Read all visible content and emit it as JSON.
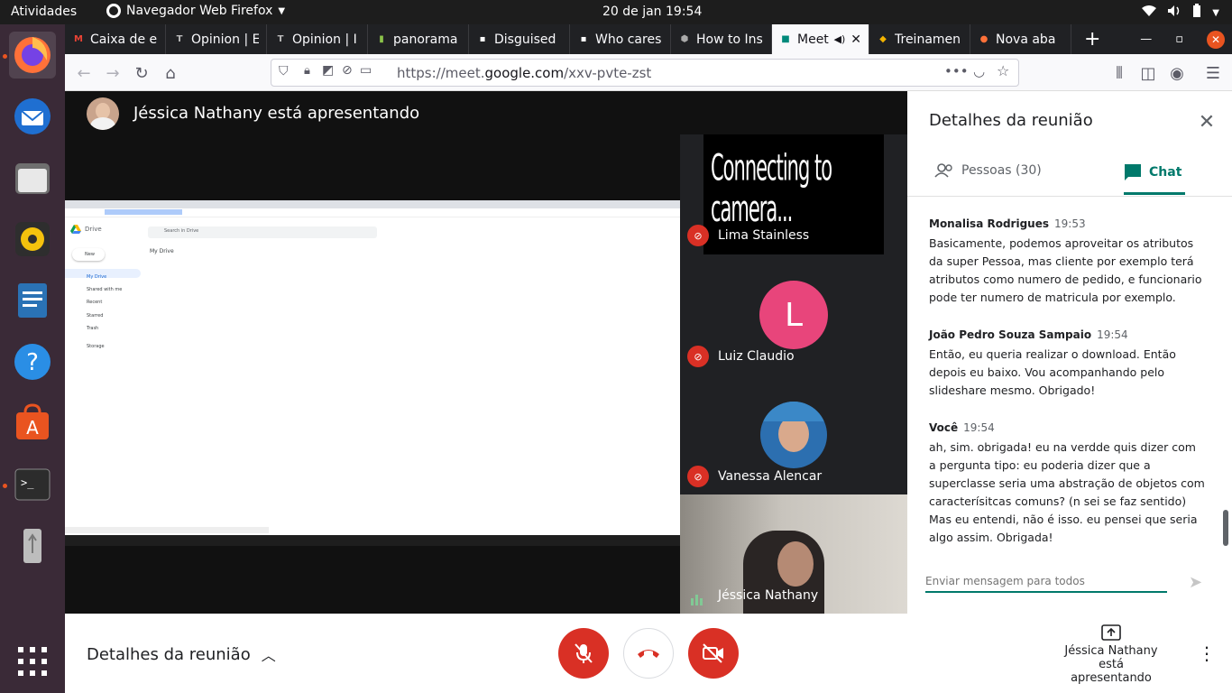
{
  "topbar": {
    "activities": "Atividades",
    "app_name": "Navegador Web Firefox",
    "clock": "20 de jan  19:54"
  },
  "dock": {
    "items": [
      "firefox-icon",
      "thunderbird-icon",
      "files-icon",
      "rhythmbox-icon",
      "writer-icon",
      "help-icon",
      "software-icon",
      "terminal-icon",
      "usb-drive-icon",
      "show-apps-icon"
    ]
  },
  "browser": {
    "tabs": [
      {
        "label": "Caixa de e",
        "icon": "M",
        "color": "#ea4335"
      },
      {
        "label": "Opinion | E",
        "icon": "T",
        "color": "#bbbbbb"
      },
      {
        "label": "Opinion | I",
        "icon": "T",
        "color": "#bbbbbb"
      },
      {
        "label": "panorama",
        "icon": "▮",
        "color": "#8bc34a"
      },
      {
        "label": "Disguised",
        "icon": "▪",
        "color": "#ffffff"
      },
      {
        "label": "Who cares",
        "icon": "▪",
        "color": "#ffffff"
      },
      {
        "label": "How to Ins",
        "icon": "⬢",
        "color": "#aaaaaa"
      },
      {
        "label": "Meet",
        "icon": "■",
        "color": "#00897b",
        "active": true
      },
      {
        "label": "Treinamen",
        "icon": "◆",
        "color": "#f4b400"
      },
      {
        "label": "Nova aba",
        "icon": "●",
        "color": "#ff7139"
      }
    ],
    "url_prefix": "https://meet.",
    "url_domain": "google.com",
    "url_path": "/xxv-pvte-zst"
  },
  "meet": {
    "presenter_text": "Jéssica Nathany está apresentando",
    "participants": [
      {
        "name": "Lima Stainless",
        "overlay": "Connecting to camera..."
      },
      {
        "name": "Luiz Claudio",
        "initial": "L",
        "color": "#e8457b"
      },
      {
        "name": "Vanessa Alencar"
      },
      {
        "name": "Jéssica Nathany"
      }
    ],
    "shared_screen": {
      "app": "Drive",
      "search_placeholder": "Search in Drive",
      "breadcrumb": "My Drive",
      "new_label": "New",
      "nav": [
        "My Drive",
        "Shared with me",
        "Recent",
        "Starred",
        "Trash",
        "Storage"
      ]
    }
  },
  "panel": {
    "title": "Detalhes da reunião",
    "tab_people": "Pessoas (30)",
    "tab_chat": "Chat",
    "messages": [
      {
        "sender": "Monalisa Rodrigues",
        "time": "19:53",
        "body": "Basicamente, podemos aproveitar os atributos da super Pessoa, mas cliente por exemplo terá atributos como numero de pedido, e funcionario pode ter numero de matricula por exemplo."
      },
      {
        "sender": "João Pedro Souza Sampaio",
        "time": "19:54",
        "body": "Então, eu queria realizar o download. Então depois eu baixo. Vou acompanhando pelo slideshare mesmo. Obrigado!"
      },
      {
        "sender": "Você",
        "time": "19:54",
        "body": "ah, sim. obrigada! eu na verdde quis dizer com a pergunta tipo: eu poderia dizer que a superclasse seria uma abstração de objetos com caracterísitcas comuns? (n sei se faz sentido) Mas eu entendi, não é isso. eu pensei que seria algo assim. Obrigada!"
      }
    ],
    "composer_placeholder": "Enviar mensagem para todos"
  },
  "bottombar": {
    "details_label": "Detalhes da reunião",
    "present_status": "Jéssica Nathany está apresentando"
  },
  "colors": {
    "danger": "#d93025",
    "accent": "#00796b",
    "ubuntu_orange": "#e95420"
  }
}
